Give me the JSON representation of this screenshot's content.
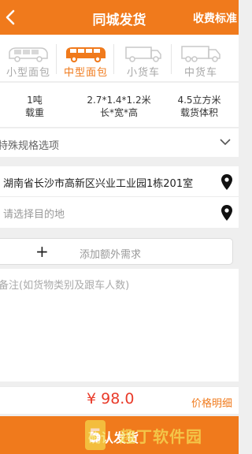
{
  "header": {
    "title": "同城发货",
    "right_link": "收费标准"
  },
  "vehicle_tabs": [
    {
      "label": "小型面包",
      "icon": "minivan-icon",
      "active": false
    },
    {
      "label": "中型面包",
      "icon": "van-icon",
      "active": true
    },
    {
      "label": "小货车",
      "icon": "small-truck-icon",
      "active": false
    },
    {
      "label": "中货车",
      "icon": "medium-truck-icon",
      "active": false
    }
  ],
  "specs": {
    "load": {
      "value": "1吨",
      "label": "载重"
    },
    "dimensions": {
      "value": "2.7*1.4*1.2米",
      "label": "长*宽*高"
    },
    "volume": {
      "value": "4.5立方米",
      "label": "载货体积"
    }
  },
  "special_options": {
    "label": "特殊规格选项",
    "icon": "chevron-down-icon"
  },
  "address": {
    "origin": "湖南省长沙市高新区兴业工业园1栋201室",
    "destination_placeholder": "请选择目的地"
  },
  "extra_needs": {
    "label": "添加额外需求",
    "icon": "plus-icon"
  },
  "remarks": {
    "placeholder": "备注(如货物类别及跟车人数)"
  },
  "price": {
    "amount": "¥ 98.0",
    "detail_link": "价格明细"
  },
  "action": {
    "label": "确认发货"
  },
  "watermark": {
    "text": "趣丁软件园"
  },
  "colors": {
    "accent": "#f07a1c",
    "price": "#e93b2a",
    "inactive": "#a8a8a8"
  }
}
